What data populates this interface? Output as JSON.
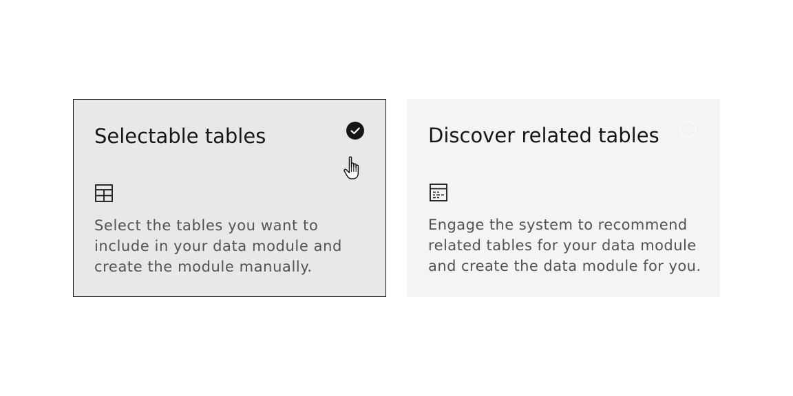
{
  "tiles": [
    {
      "title": "Selectable tables",
      "description": "Select the tables you want to include in your data module and create the module manually.",
      "selected": true,
      "icon": "table-icon"
    },
    {
      "title": "Discover related tables",
      "description": "Engage the system to recommend related tables for your data module and create the data module for you.",
      "selected": false,
      "icon": "data-table-reference-icon"
    }
  ],
  "colors": {
    "selected_background": "#e8e8e8",
    "unselected_background": "#f4f4f4",
    "border": "#161616",
    "title_text": "#161616",
    "body_text": "#525252"
  }
}
